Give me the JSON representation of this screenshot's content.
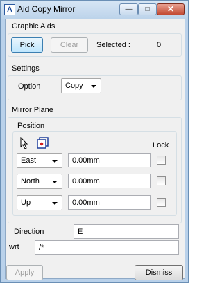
{
  "window": {
    "title": "Aid Copy Mirror",
    "app_icon_letter": "A",
    "controls": {
      "minimize": "—",
      "maximize": "□",
      "close": "✕"
    }
  },
  "graphic_aids": {
    "label": "Graphic Aids",
    "pick_label": "Pick",
    "clear_label": "Clear",
    "selected_label": "Selected :",
    "selected_count": "0"
  },
  "settings": {
    "label": "Settings",
    "option_label": "Option",
    "option_value": "Copy"
  },
  "mirror_plane": {
    "label": "Mirror Plane",
    "position": {
      "label": "Position",
      "lock_label": "Lock",
      "rows": [
        {
          "direction": "East",
          "value": "0.00mm",
          "locked": false
        },
        {
          "direction": "North",
          "value": "0.00mm",
          "locked": false
        },
        {
          "direction": "Up",
          "value": "0.00mm",
          "locked": false
        }
      ],
      "icons": [
        "cursor-arrow-icon",
        "select-element-icon"
      ]
    },
    "direction_label": "Direction",
    "direction_value": "E",
    "wrt_label": "wrt",
    "wrt_value": "/*"
  },
  "footer": {
    "apply_label": "Apply",
    "dismiss_label": "Dismiss"
  },
  "colors": {
    "title_bar": "#bcd3ea",
    "close_button": "#c24a33",
    "panel": "#f0f0f0",
    "focus": "#3c7fb1"
  }
}
